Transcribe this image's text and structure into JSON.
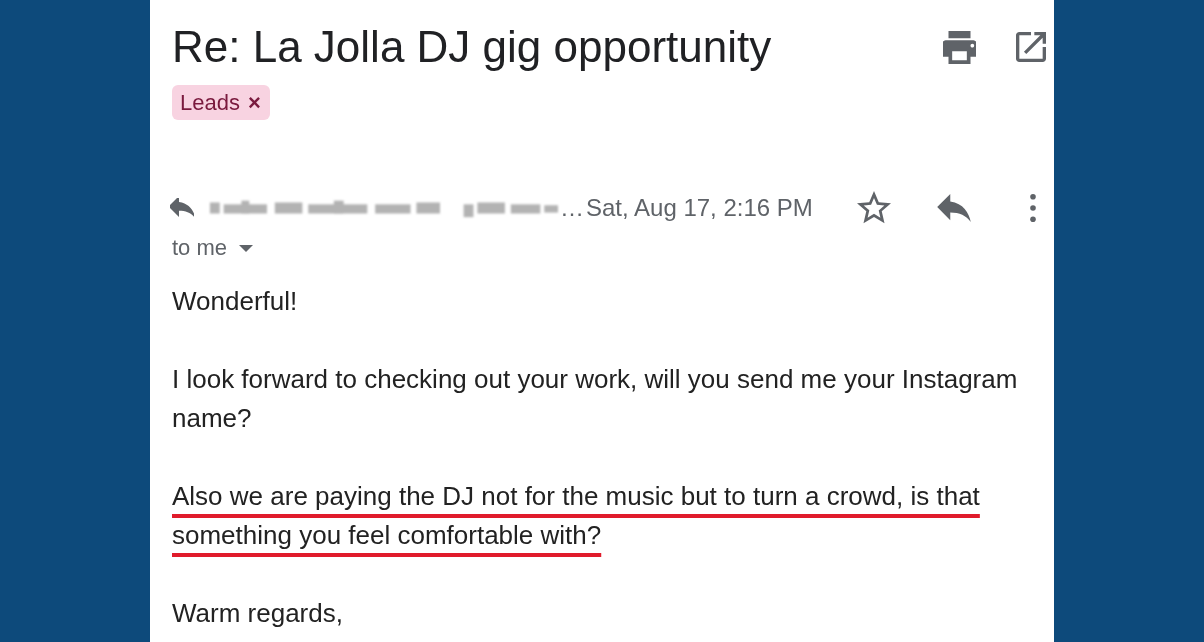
{
  "email": {
    "subject": "Re: La Jolla DJ gig opportunity",
    "labels": [
      {
        "name": "Leads",
        "remove": "×",
        "color": "#f8d3e1"
      }
    ]
  },
  "message": {
    "sender_ellipsis": "…",
    "date": "Sat, Aug 17, 2:16 PM",
    "starred": false,
    "recipients": "to me"
  },
  "body": [
    {
      "text": "Wonderful!",
      "underlined": false
    },
    {
      "text": "I look forward to checking out your work, will you send me your Instagram name?",
      "underlined": false
    },
    {
      "text": "Also we are paying the DJ not for the music but to turn a crowd, is that something you feel comfortable with?",
      "underlined": true
    },
    {
      "text": "Warm regards,",
      "underlined": false
    }
  ]
}
